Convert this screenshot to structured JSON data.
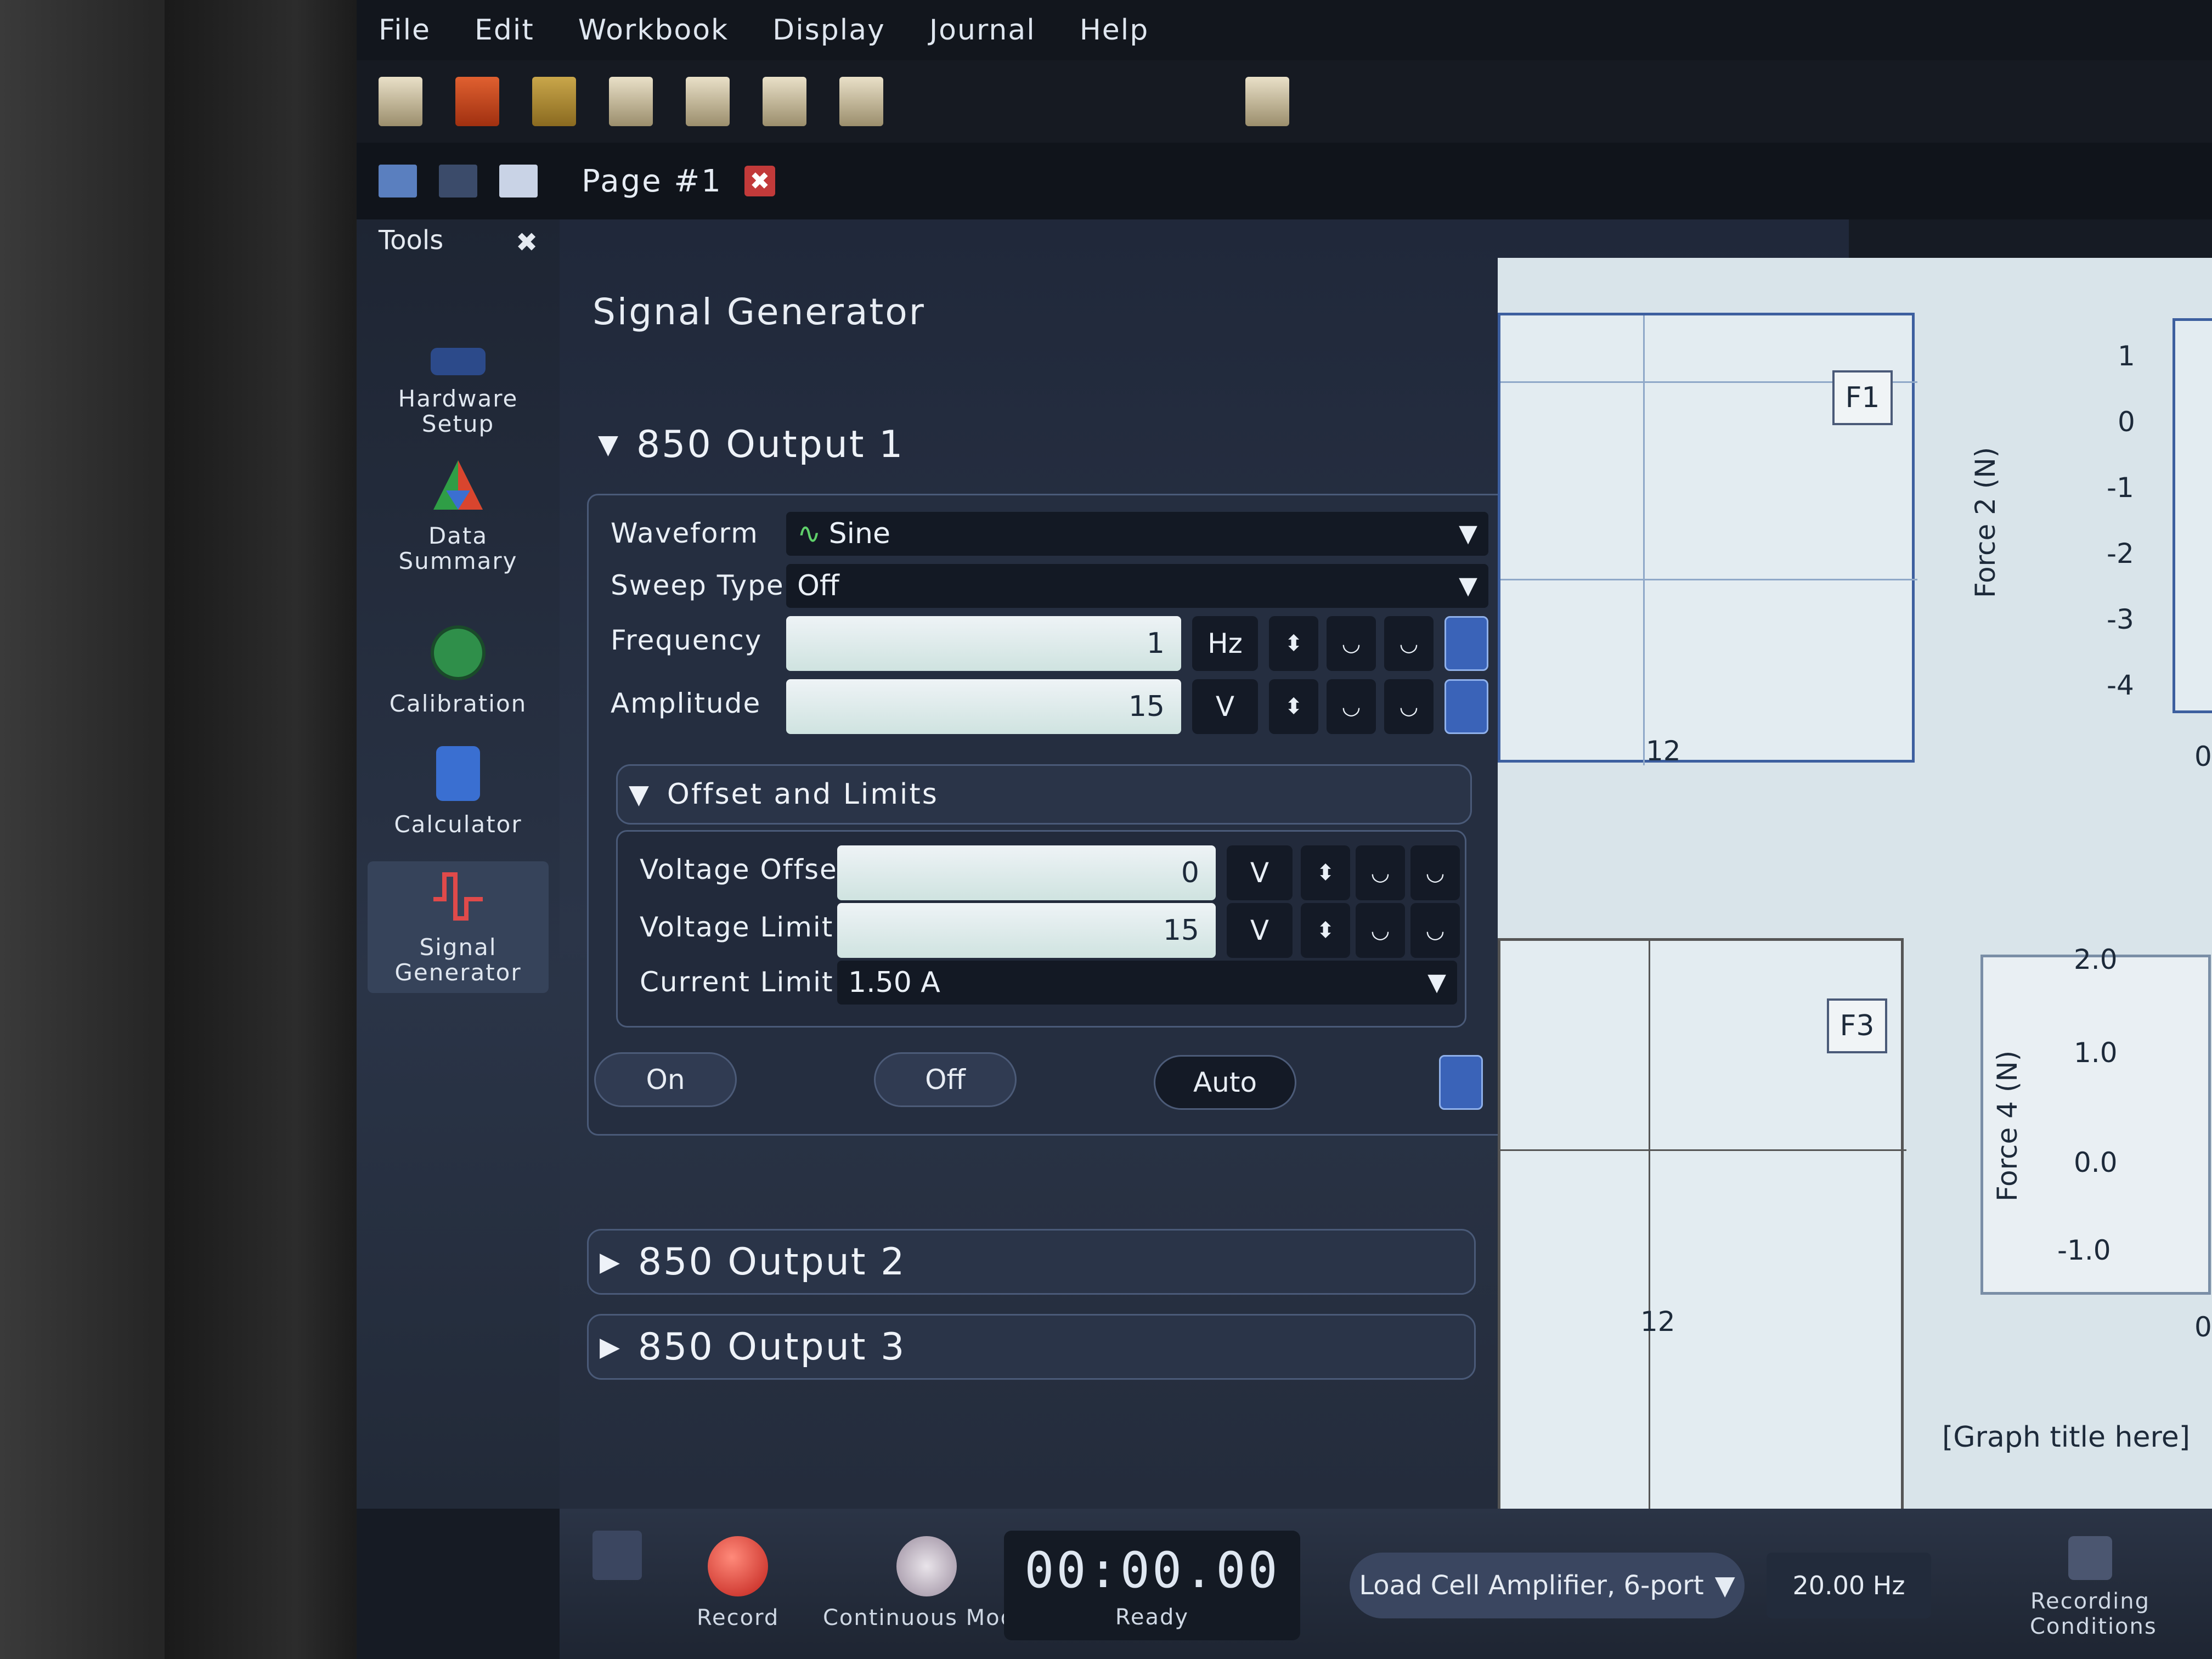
{
  "menu": {
    "items": [
      "File",
      "Edit",
      "Workbook",
      "Display",
      "Journal",
      "Help"
    ]
  },
  "tab": {
    "page_label": "Page #1",
    "close_glyph": "✖"
  },
  "tools": {
    "header": "Tools",
    "close_glyph": "✖",
    "items": [
      {
        "label": "Hardware Setup",
        "icon": "hardware-icon"
      },
      {
        "label": "Data Summary",
        "icon": "data-summary-icon"
      },
      {
        "label": "Calibration",
        "icon": "calibration-icon"
      },
      {
        "label": "Calculator",
        "icon": "calculator-icon"
      },
      {
        "label": "Signal Generator",
        "icon": "signal-generator-icon",
        "active": true
      }
    ]
  },
  "signal_generator": {
    "title": "Signal Generator",
    "output1": {
      "header": "850 Output 1",
      "waveform_label": "Waveform",
      "waveform_value": "Sine",
      "sweep_label": "Sweep Type",
      "sweep_value": "Off",
      "frequency_label": "Frequency",
      "frequency_value": "1",
      "frequency_unit": "Hz",
      "amplitude_label": "Amplitude",
      "amplitude_value": "15",
      "amplitude_unit": "V",
      "offset_header": "Offset and Limits",
      "voltage_offset_label": "Voltage Offset",
      "voltage_offset_value": "0",
      "voltage_offset_unit": "V",
      "voltage_limit_label": "Voltage Limit",
      "voltage_limit_value": "15",
      "voltage_limit_unit": "V",
      "current_limit_label": "Current Limit",
      "current_limit_value": "1.50 A",
      "on_label": "On",
      "off_label": "Off",
      "auto_label": "Auto"
    },
    "output2": {
      "header": "850 Output 2"
    },
    "output3": {
      "header": "850 Output 3"
    }
  },
  "graphs": {
    "top": {
      "tag": "F1",
      "y_title": "Force 2 (N)",
      "y_ticks": [
        "1",
        "0",
        "-1",
        "-2",
        "-3",
        "-4"
      ],
      "x_tick": "12",
      "x_tick_right": "0"
    },
    "bottom": {
      "tag": "F3",
      "y_title": "Force 4 (N)",
      "y_ticks": [
        "2.0",
        "1.0",
        "0.0",
        "-1.0"
      ],
      "x_tick": "12",
      "x_tick_right": "0",
      "title": "[Graph title here]"
    }
  },
  "controls": {
    "record_label": "Record",
    "mode_label": "Continuous Mode",
    "timer": "00:00.00",
    "status": "Ready",
    "sensor": "Load Cell Amplifier, 6-port",
    "rate": "20.00 Hz",
    "recording_conditions_label": "Recording Conditions"
  }
}
